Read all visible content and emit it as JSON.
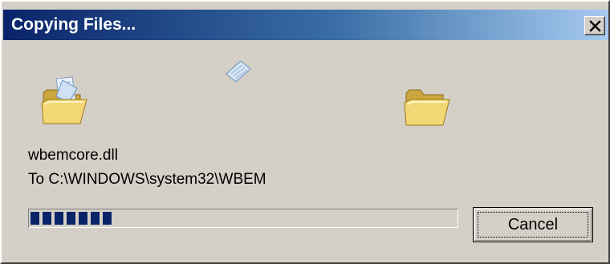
{
  "window": {
    "title": "Copying Files...",
    "close_icon": "close-icon"
  },
  "animation": {
    "source_icon": "open-folder-with-document-icon",
    "flying_icon": "flying-document-icon",
    "destination_icon": "open-folder-icon"
  },
  "copy": {
    "filename": "wbemcore.dll",
    "destination": "To C:\\WINDOWS\\system32\\WBEM"
  },
  "progress": {
    "fraction": 0.2
  },
  "buttons": {
    "cancel_label": "Cancel"
  },
  "colors": {
    "title_gradient_start": "#0a246a",
    "title_gradient_end": "#a6caf0",
    "dialog_face": "#d4d0c8",
    "progress_block": "#0a246a"
  }
}
